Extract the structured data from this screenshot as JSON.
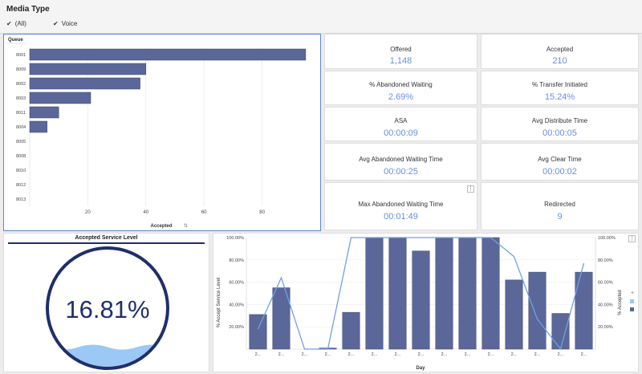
{
  "header": {
    "title": "Media Type",
    "filters": [
      {
        "label": "(All)",
        "checked": true
      },
      {
        "label": "Voice",
        "checked": true
      }
    ]
  },
  "queue_chart": {
    "title": "Queue",
    "xlabel": "Accepted",
    "xlabel_icon": "sort-icon"
  },
  "kpis": [
    {
      "label": "Offered",
      "value": "1,148"
    },
    {
      "label": "Accepted",
      "value": "210"
    },
    {
      "label": "% Abandoned Waiting",
      "value": "2.69%"
    },
    {
      "label": "% Transfer Initiated",
      "value": "15.24%"
    },
    {
      "label": "ASA",
      "value": "00:00:09"
    },
    {
      "label": "Avg Distribute Time",
      "value": "00:00:05"
    },
    {
      "label": "Avg Abandoned Waiting Time",
      "value": "00:00:25"
    },
    {
      "label": "Avg Clear Time",
      "value": "00:00:02"
    },
    {
      "label": "Max Abandoned Waiting Time",
      "value": "00:01:49"
    },
    {
      "label": "Redirected",
      "value": "9"
    }
  ],
  "gauge": {
    "title": "Accepted Service Level",
    "value_text": "16.81%",
    "value": 0.1681
  },
  "day_chart": {
    "xlabel": "Day",
    "ylabel_left": "% Accept Service Level",
    "ylabel_right": "% Accepted",
    "tick_label": "2..."
  },
  "colors": {
    "bar": "#5b6798",
    "line": "#6fa0e8",
    "kpi_value": "#6a8de0",
    "gauge_ring": "#1f2f6b",
    "gauge_wave": "#9cc8f5"
  },
  "chart_data": [
    {
      "type": "bar",
      "orientation": "horizontal",
      "categories": [
        "8001",
        "8009",
        "8002",
        "8003",
        "8011",
        "8004",
        "8005",
        "8008",
        "8010",
        "8012",
        "8013"
      ],
      "values": [
        95,
        40,
        38,
        21,
        10,
        6,
        0,
        0,
        0,
        0,
        0
      ],
      "xlim": [
        0,
        100
      ],
      "xticks": [
        20,
        40,
        60,
        80
      ],
      "xlabel": "Accepted",
      "ylabel": "Queue",
      "grid": true
    },
    {
      "type": "bar",
      "categories": [
        "2...",
        "2...",
        "2...",
        "2...",
        "2...",
        "2...",
        "2...",
        "2...",
        "2...",
        "2...",
        "2...",
        "2...",
        "2...",
        "2...",
        "2..."
      ],
      "series": [
        {
          "name": "% Accepted",
          "type": "bar",
          "axis": "right",
          "values": [
            31,
            55,
            0,
            1,
            33,
            100,
            100,
            88,
            100,
            100,
            100,
            62,
            69,
            32,
            69
          ]
        },
        {
          "name": "% Accept Service Level",
          "type": "line",
          "axis": "left",
          "values": [
            18,
            64,
            0,
            0,
            100,
            100,
            100,
            100,
            100,
            100,
            100,
            83,
            27,
            0,
            77
          ]
        }
      ],
      "ylim": [
        0,
        100
      ],
      "yticks": [
        "20.00%",
        "40.00%",
        "60.00%",
        "80.00%",
        "100.00%"
      ],
      "xlabel": "Day",
      "ylabel": "% Accept Service Level",
      "y2label": "% Accepted",
      "grid": true
    }
  ]
}
